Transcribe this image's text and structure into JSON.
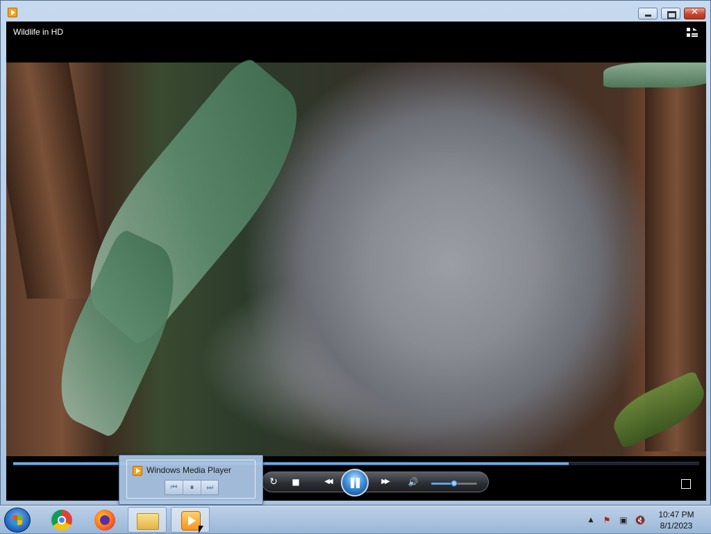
{
  "window": {
    "title": "",
    "controls": {
      "minimize": "",
      "maximize": "",
      "close": "✕"
    }
  },
  "player": {
    "video_title": "Wildlife in HD",
    "seek_progress": 0.81,
    "volume_level": 0.5,
    "controls": {
      "repeat": "↻",
      "stop": "■",
      "previous": "◀◀",
      "next": "▶▶",
      "mute": "🔊"
    }
  },
  "thumbnail": {
    "title": "Windows Media Player",
    "buttons": {
      "previous": "⏮",
      "pause": "⏸",
      "next": "⏭"
    }
  },
  "taskbar": {
    "items": [
      "start",
      "chrome",
      "firefox",
      "file-explorer",
      "windows-media-player"
    ],
    "tray": {
      "show_hidden": "▲",
      "flag": "⚑",
      "network": "▣",
      "volume": "🔇"
    },
    "clock": {
      "time": "10:47 PM",
      "date": "8/1/2023"
    }
  },
  "colors": {
    "accent": "#3c7fc4",
    "window_frame": "#a9c2df",
    "close_button": "#c7462f"
  }
}
